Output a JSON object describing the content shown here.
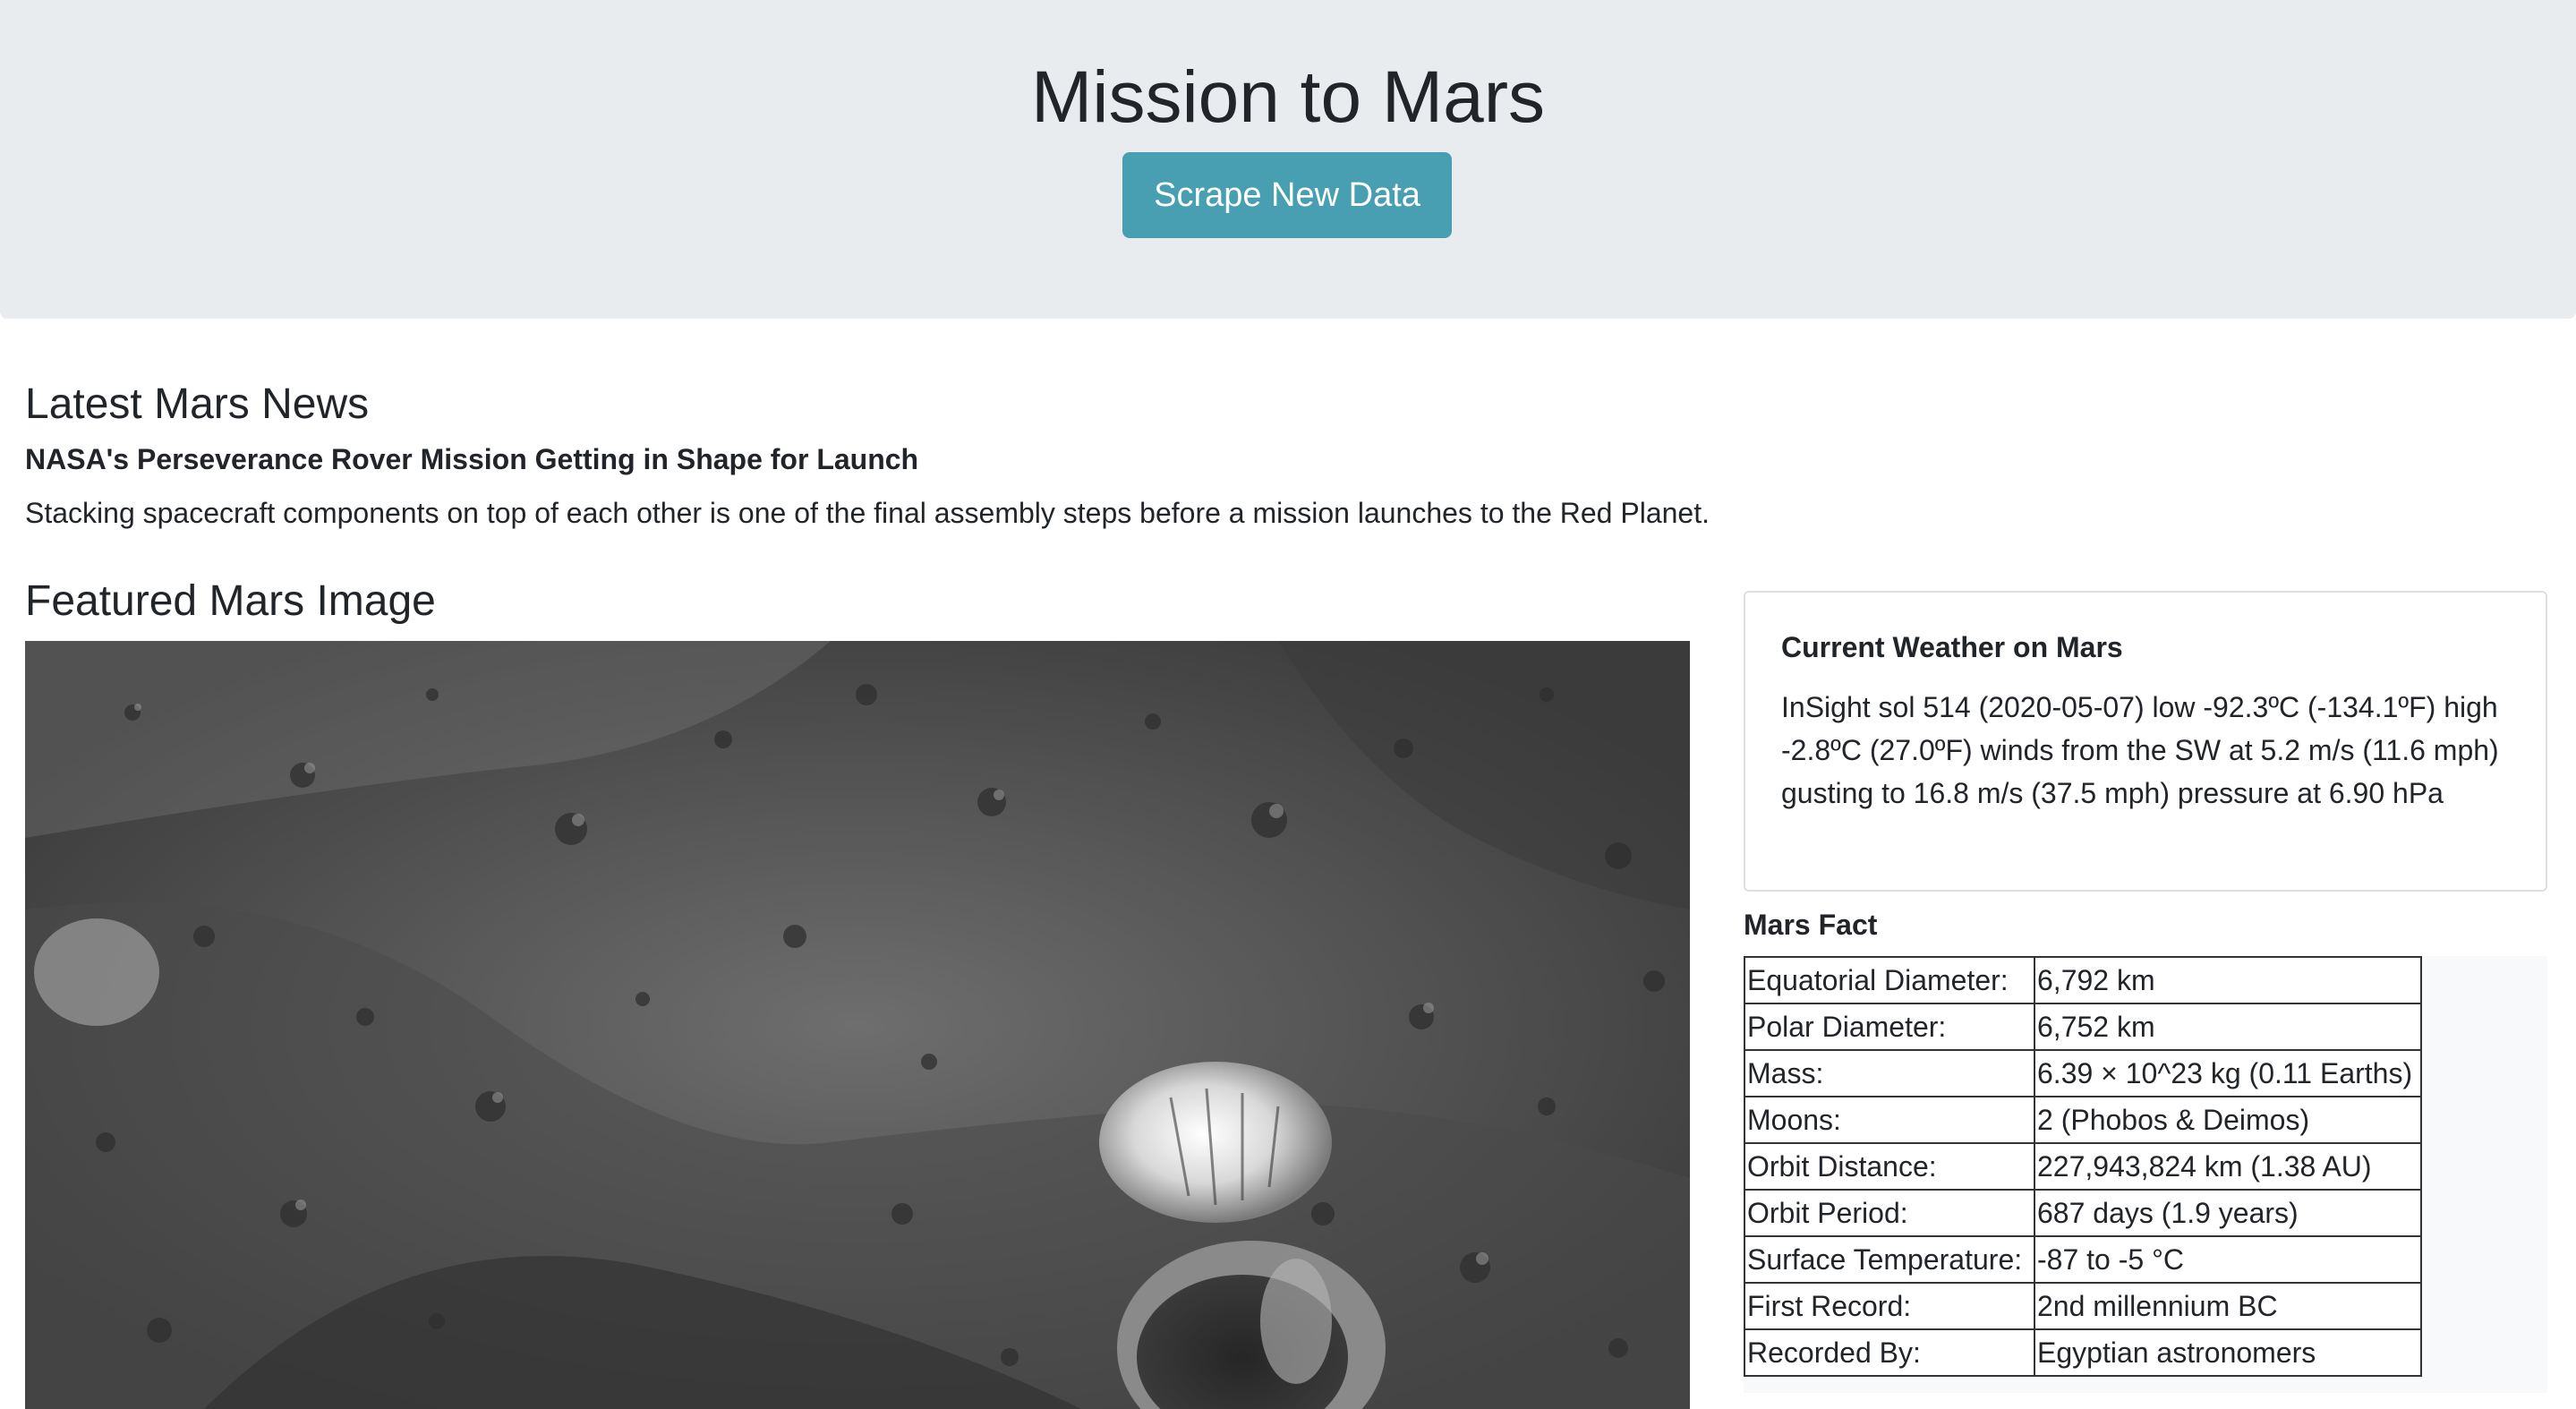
{
  "header": {
    "title": "Mission to Mars",
    "scrape_button_label": "Scrape New Data"
  },
  "news": {
    "heading": "Latest Mars News",
    "title": "NASA's Perseverance Rover Mission Getting in Shape for Launch",
    "teaser": "Stacking spacecraft components on top of each other is one of the final assembly steps before a mission launches to the Red Planet."
  },
  "featured_image": {
    "heading": "Featured Mars Image"
  },
  "weather": {
    "title": "Current Weather on Mars",
    "text": "InSight sol 514 (2020-05-07) low -92.3ºC (-134.1ºF) high -2.8ºC (27.0ºF) winds from the SW at 5.2 m/s (11.6 mph) gusting to 16.8 m/s (37.5 mph) pressure at 6.90 hPa"
  },
  "facts": {
    "title": "Mars Fact",
    "rows": [
      {
        "label": "Equatorial Diameter:",
        "value": "6,792 km"
      },
      {
        "label": "Polar Diameter:",
        "value": "6,752 km"
      },
      {
        "label": "Mass:",
        "value": "6.39 × 10^23 kg (0.11 Earths)"
      },
      {
        "label": "Moons:",
        "value": "2 (Phobos & Deimos)"
      },
      {
        "label": "Orbit Distance:",
        "value": "227,943,824 km (1.38 AU)"
      },
      {
        "label": "Orbit Period:",
        "value": "687 days (1.9 years)"
      },
      {
        "label": "Surface Temperature:",
        "value": "-87 to -5 °C"
      },
      {
        "label": "First Record:",
        "value": "2nd millennium BC"
      },
      {
        "label": "Recorded By:",
        "value": "Egyptian astronomers"
      }
    ]
  }
}
